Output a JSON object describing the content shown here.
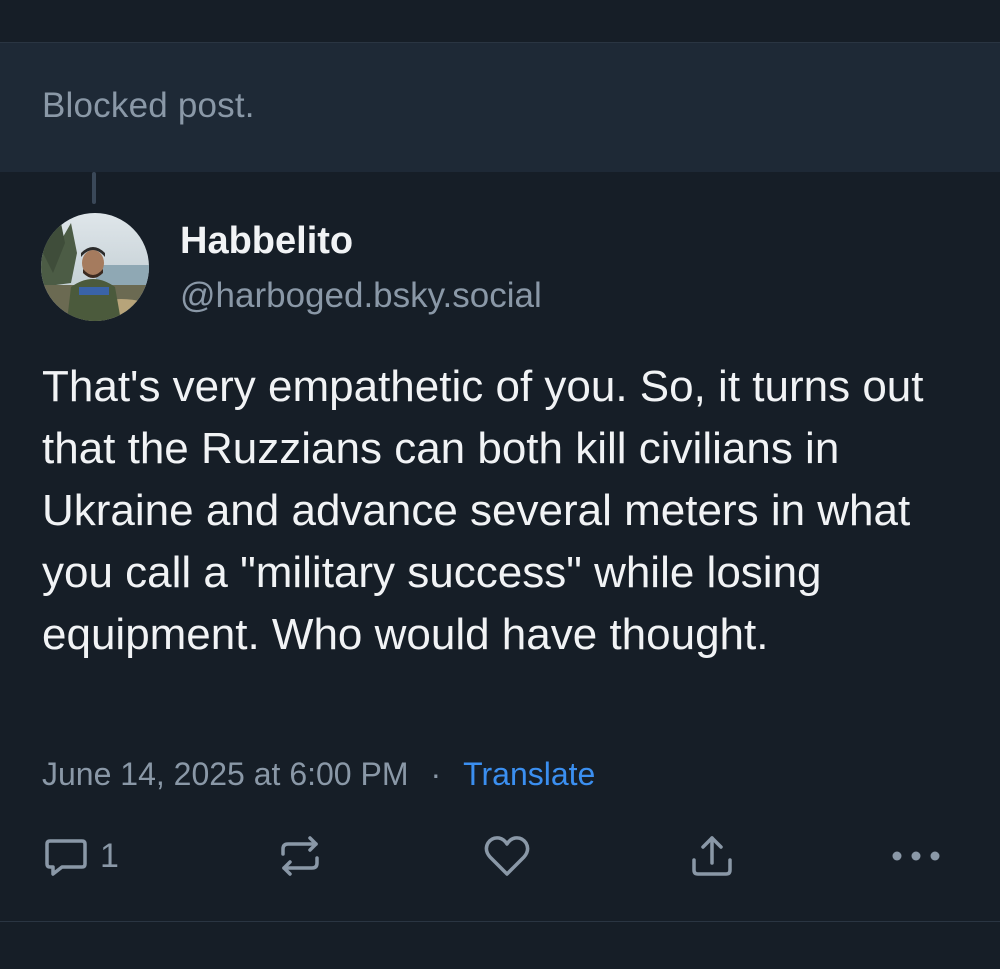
{
  "blocked": {
    "text": "Blocked post."
  },
  "post": {
    "author": {
      "display_name": "Habbelito",
      "handle": "@harboged.bsky.social"
    },
    "text": "That's very empathetic of you. So, it turns out that the Ruzzians can both kill civilians in Ukraine and advance several meters in what you call a \"military success\" while losing equipment. Who would have thought.",
    "timestamp": "June 14, 2025 at 6:00 PM",
    "separator": "·",
    "translate_label": "Translate",
    "reply_count": "1"
  },
  "icons": {
    "reply": "reply-bubble-icon",
    "repost": "repost-icon",
    "like": "heart-icon",
    "share": "share-icon",
    "more": "more-dots-icon"
  },
  "colors": {
    "background": "#161e27",
    "blocked_background": "#1e2936",
    "text_primary": "#f1f3f5",
    "text_secondary": "#8a98a7",
    "link": "#3b8ff0"
  }
}
